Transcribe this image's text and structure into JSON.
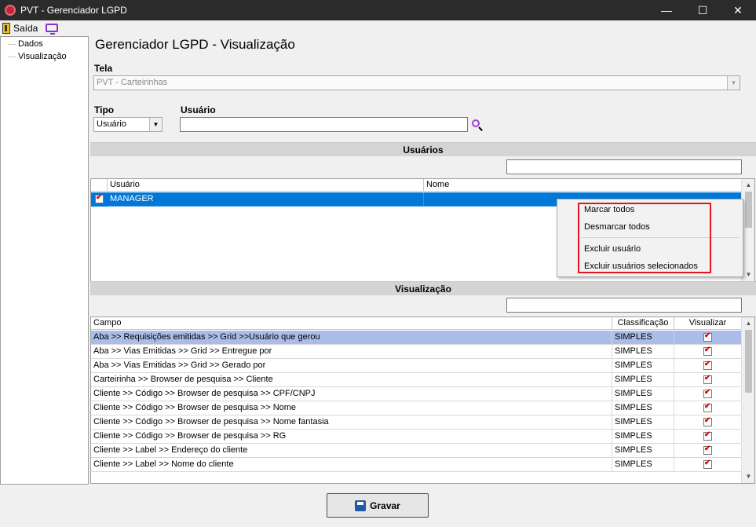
{
  "window": {
    "title": "PVT - Gerenciador LGPD",
    "minimize": "—",
    "maximize": "☐",
    "close": "✕"
  },
  "menu": {
    "saida": "Saída"
  },
  "tree": {
    "items": [
      "Dados",
      "Visualização"
    ]
  },
  "page": {
    "title": "Gerenciador LGPD - Visualização"
  },
  "tela": {
    "label": "Tela",
    "value": "PVT - Carteirinhas"
  },
  "tipo": {
    "label": "Tipo",
    "value": "Usuário"
  },
  "usuario": {
    "label": "Usuário",
    "value": ""
  },
  "usuarios_section": {
    "title": "Usuários",
    "filter": "",
    "columns": [
      "Usuário",
      "Nome"
    ],
    "rows": [
      {
        "checked": true,
        "usuario": "MANAGER",
        "nome": ""
      }
    ]
  },
  "context_menu": {
    "items": [
      "Marcar todos",
      "Desmarcar todos",
      "Excluir usuário",
      "Excluir usuários selecionados"
    ]
  },
  "visualizacao_section": {
    "title": "Visualização",
    "filter": "",
    "columns": [
      "Campo",
      "Classificação",
      "Visualizar"
    ],
    "rows": [
      {
        "campo": "Aba >> Requisições emitidas  >> Grid >>Usuário que gerou",
        "classificacao": "SIMPLES",
        "visualizar": true
      },
      {
        "campo": "Aba >> Vias Emitidas >> Grid >> Entregue por",
        "classificacao": "SIMPLES",
        "visualizar": true
      },
      {
        "campo": "Aba >> Vias Emitidas >> Grid >> Gerado por",
        "classificacao": "SIMPLES",
        "visualizar": true
      },
      {
        "campo": "Carteirinha >> Browser de pesquisa >> Cliente",
        "classificacao": "SIMPLES",
        "visualizar": true
      },
      {
        "campo": "Cliente >> Código >> Browser de pesquisa >> CPF/CNPJ",
        "classificacao": "SIMPLES",
        "visualizar": true
      },
      {
        "campo": "Cliente >> Código >> Browser de pesquisa >> Nome",
        "classificacao": "SIMPLES",
        "visualizar": true
      },
      {
        "campo": "Cliente >> Código >> Browser de pesquisa >> Nome fantasia",
        "classificacao": "SIMPLES",
        "visualizar": true
      },
      {
        "campo": "Cliente >> Código >> Browser de pesquisa >> RG",
        "classificacao": "SIMPLES",
        "visualizar": true
      },
      {
        "campo": "Cliente >> Label >> Endereço do cliente",
        "classificacao": "SIMPLES",
        "visualizar": true
      },
      {
        "campo": "Cliente >> Label >> Nome do cliente",
        "classificacao": "SIMPLES",
        "visualizar": true
      }
    ]
  },
  "save": {
    "label": "Gravar"
  },
  "colors": {
    "selection_blue": "#0078d7",
    "row_highlight": "#a9bde8",
    "annotation_red": "#e0161e"
  }
}
